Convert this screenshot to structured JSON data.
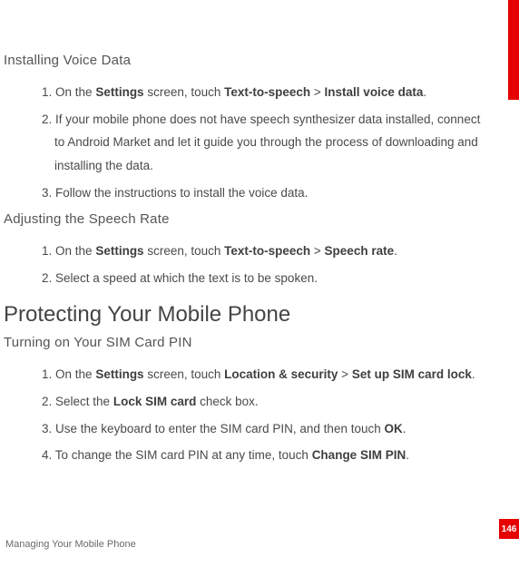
{
  "redbar": "",
  "pageNumber": "146",
  "footer": "Managing Your Mobile Phone",
  "section1": {
    "heading": "Installing Voice Data",
    "items": [
      {
        "num": "1.",
        "pre": "On the ",
        "b1": "Settings",
        "mid1": " screen, touch ",
        "b2": "Text-to-speech",
        "mid2": " > ",
        "b3": "Install voice data",
        "post": "."
      },
      {
        "num": "2.",
        "text": "If your mobile phone does not have speech synthesizer data installed, connect to Android Market and let it guide you through the process of downloading and installing the data."
      },
      {
        "num": "3.",
        "text": "Follow the instructions to install the voice data."
      }
    ]
  },
  "section2": {
    "heading": "Adjusting the Speech Rate",
    "items": [
      {
        "num": "1.",
        "pre": "On the ",
        "b1": "Settings",
        "mid1": " screen, touch ",
        "b2": "Text-to-speech",
        "mid2": " > ",
        "b3": "Speech rate",
        "post": "."
      },
      {
        "num": "2.",
        "text": "Select a speed at which the text is to be spoken."
      }
    ]
  },
  "chapter": {
    "heading": "Protecting Your Mobile Phone"
  },
  "section3": {
    "heading": "Turning on Your SIM Card PIN",
    "items": [
      {
        "num": "1.",
        "pre": "On the ",
        "b1": "Settings",
        "mid1": " screen, touch ",
        "b2": "Location & security",
        "mid2": " > ",
        "b3": "Set up SIM card lock",
        "post": "."
      },
      {
        "num": "2.",
        "pre": "Select the ",
        "b1": "Lock SIM card",
        "post": " check box."
      },
      {
        "num": "3.",
        "pre": "Use the keyboard to enter the SIM card PIN, and then touch ",
        "b1": "OK",
        "post": "."
      },
      {
        "num": "4.",
        "pre": "To change the SIM card PIN at any time, touch ",
        "b1": "Change SIM PIN",
        "post": "."
      }
    ]
  }
}
